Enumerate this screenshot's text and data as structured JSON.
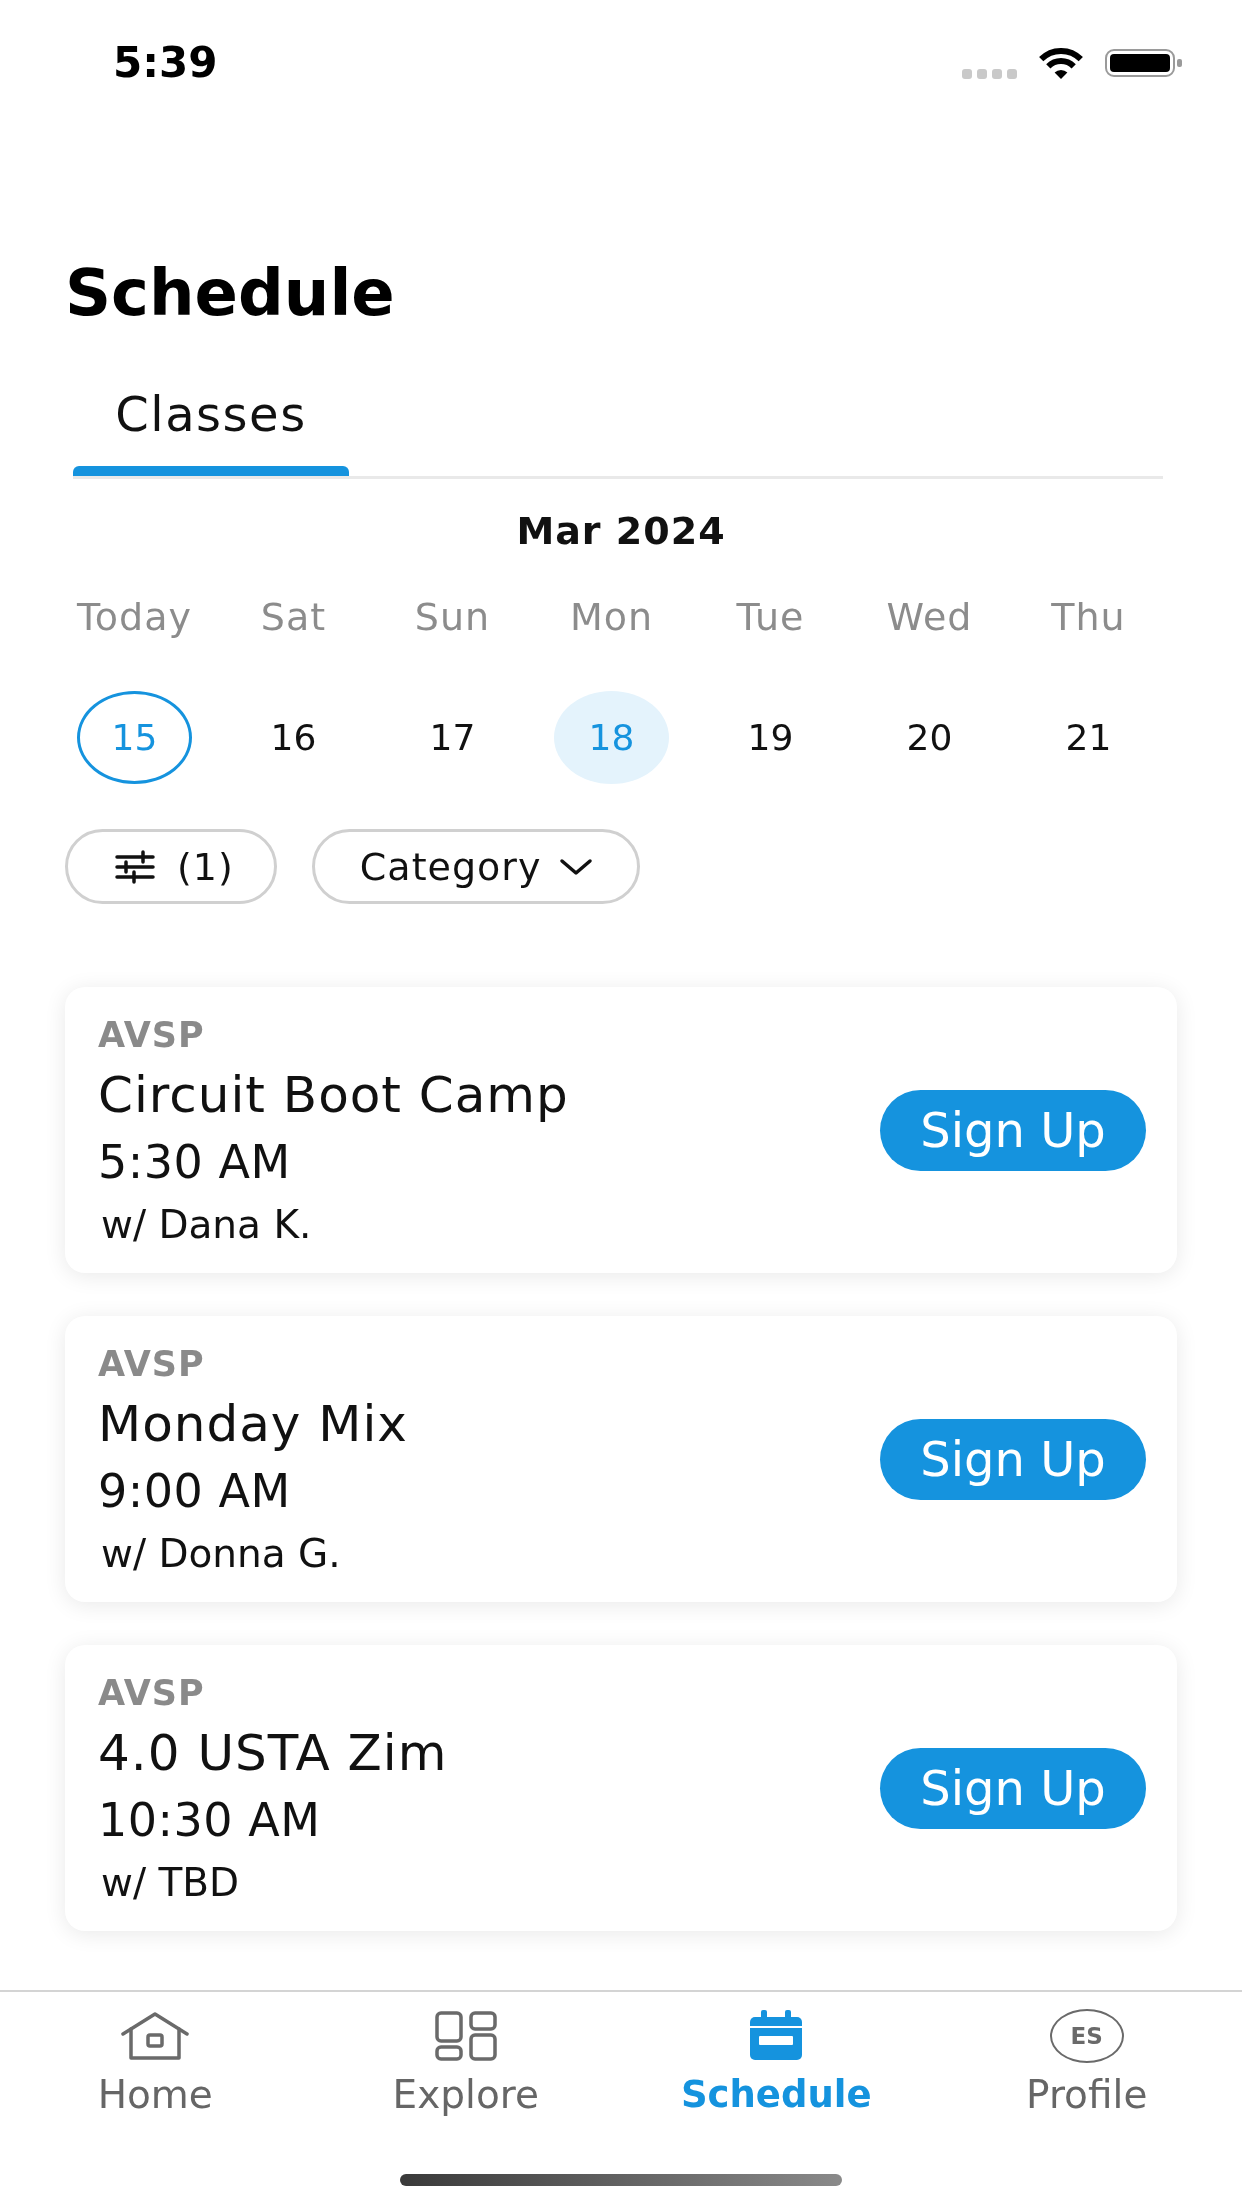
{
  "status_bar": {
    "time": "5:39"
  },
  "header": {
    "title": "Schedule"
  },
  "tabs": [
    {
      "label": "Classes",
      "selected": true
    }
  ],
  "calendar": {
    "month": "Mar 2024",
    "days": [
      {
        "weekday": "Today",
        "date": "15",
        "today": true,
        "selected": false
      },
      {
        "weekday": "Sat",
        "date": "16",
        "today": false,
        "selected": false
      },
      {
        "weekday": "Sun",
        "date": "17",
        "today": false,
        "selected": false
      },
      {
        "weekday": "Mon",
        "date": "18",
        "today": false,
        "selected": true
      },
      {
        "weekday": "Tue",
        "date": "19",
        "today": false,
        "selected": false
      },
      {
        "weekday": "Wed",
        "date": "20",
        "today": false,
        "selected": false
      },
      {
        "weekday": "Thu",
        "date": "21",
        "today": false,
        "selected": false
      }
    ]
  },
  "filters": [
    {
      "kind": "filter",
      "label": "(1)"
    },
    {
      "kind": "dropdown",
      "label": "Category"
    }
  ],
  "classes": [
    {
      "location": "AVSP",
      "name": "Circuit Boot Camp",
      "time": "5:30 AM",
      "instructor": "w/ Dana K.",
      "action": "Sign Up"
    },
    {
      "location": "AVSP",
      "name": "Monday Mix",
      "time": "9:00 AM",
      "instructor": "w/ Donna G.",
      "action": "Sign Up"
    },
    {
      "location": "AVSP",
      "name": "4.0 USTA Zim",
      "time": "10:30 AM",
      "instructor": "w/ TBD",
      "action": "Sign Up"
    }
  ],
  "tab_bar": [
    {
      "kind": "home",
      "label": "Home",
      "selected": false
    },
    {
      "kind": "grid",
      "label": "Explore",
      "selected": false
    },
    {
      "kind": "calendar",
      "label": "Schedule",
      "selected": true
    },
    {
      "kind": "avatar",
      "label": "Profile",
      "initials": "ES",
      "selected": false
    }
  ]
}
